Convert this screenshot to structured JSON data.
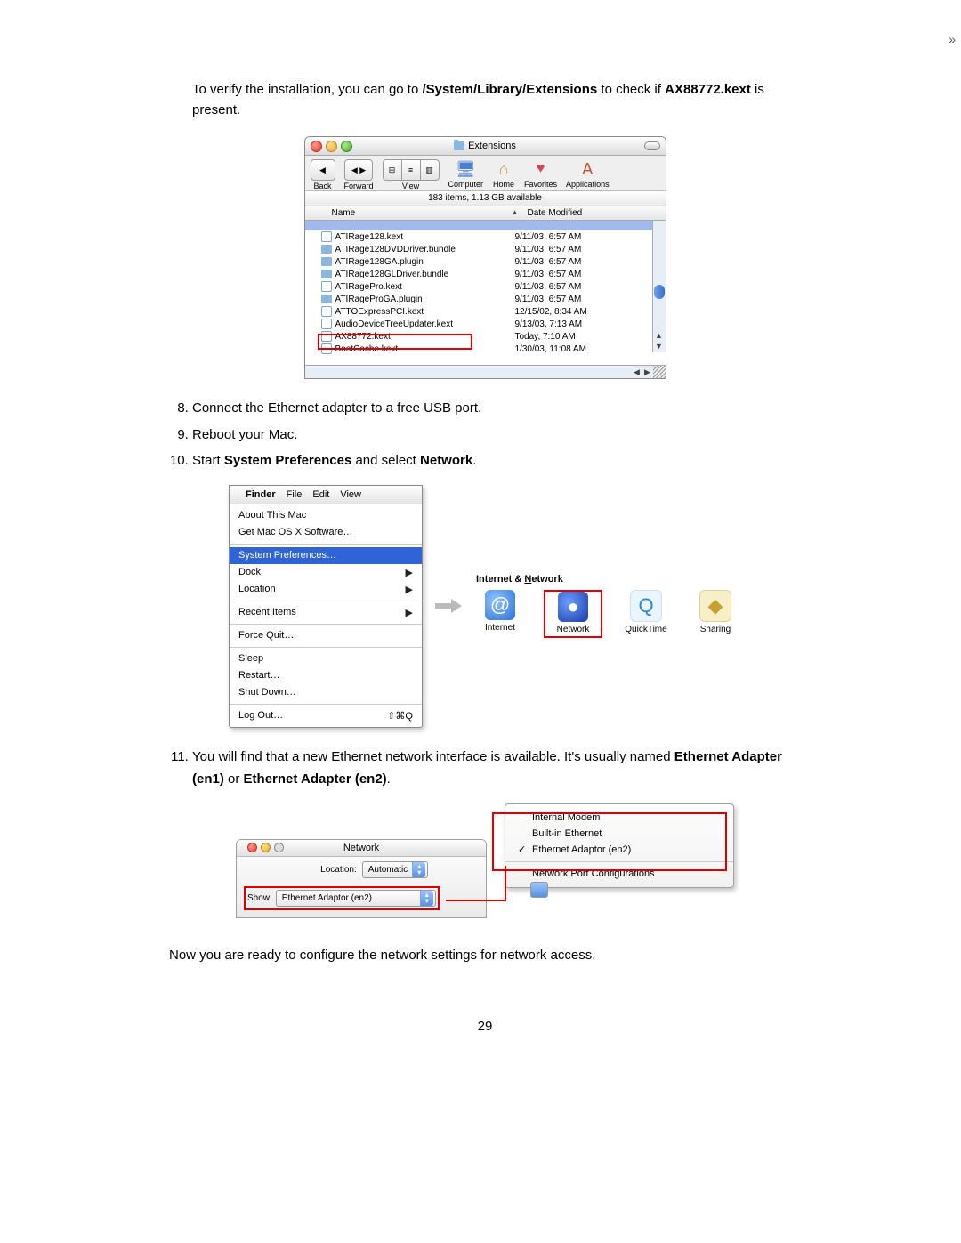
{
  "intro": {
    "pre": "To verify the installation, you can go to ",
    "path": "/System/Library/Extensions",
    "mid": " to check if ",
    "kext": "AX88772.kext",
    "post": " is present."
  },
  "finder": {
    "title": "Extensions",
    "toolbar": {
      "back": "Back",
      "forward": "Forward",
      "view": "View",
      "computer": "Computer",
      "home": "Home",
      "favorites": "Favorites",
      "applications": "Applications"
    },
    "status": "183 items, 1.13 GB available",
    "columns": {
      "name": "Name",
      "date": "Date Modified"
    },
    "files": [
      {
        "name": "ATIRage128.kext",
        "date": "9/11/03, 6:57 AM",
        "type": "kext"
      },
      {
        "name": "ATIRage128DVDDriver.bundle",
        "date": "9/11/03, 6:57 AM",
        "type": "folder"
      },
      {
        "name": "ATIRage128GA.plugin",
        "date": "9/11/03, 6:57 AM",
        "type": "folder"
      },
      {
        "name": "ATIRage128GLDriver.bundle",
        "date": "9/11/03, 6:57 AM",
        "type": "folder"
      },
      {
        "name": "ATIRagePro.kext",
        "date": "9/11/03, 6:57 AM",
        "type": "kext"
      },
      {
        "name": "ATIRageProGA.plugin",
        "date": "9/11/03, 6:57 AM",
        "type": "folder"
      },
      {
        "name": "ATTOExpressPCI.kext",
        "date": "12/15/02, 8:34 AM",
        "type": "kext"
      },
      {
        "name": "AudioDeviceTreeUpdater.kext",
        "date": "9/13/03, 7:13 AM",
        "type": "kext"
      },
      {
        "name": "AX88772.kext",
        "date": "Today, 7:10 AM",
        "type": "kext"
      },
      {
        "name": "BootCache.kext",
        "date": "1/30/03, 11:08 AM",
        "type": "kext"
      }
    ]
  },
  "steps": {
    "s8": "Connect the Ethernet adapter to a free USB port.",
    "s9": "Reboot your Mac.",
    "s10_a": "Start ",
    "s10_b": "System Preferences",
    "s10_c": " and select ",
    "s10_d": "Network",
    "s10_e": ".",
    "s11_a": "You will find that a new Ethernet network interface is available. It's usually named ",
    "s11_b": "Ethernet Adapter (en1)",
    "s11_c": " or ",
    "s11_d": "Ethernet Adapter (en2)",
    "s11_e": "."
  },
  "apple_menu": {
    "menubar": [
      "Finder",
      "File",
      "Edit",
      "View"
    ],
    "items": {
      "about": "About This Mac",
      "getsw": "Get Mac OS X Software…",
      "sysprefs": "System Preferences…",
      "dock": "Dock",
      "location": "Location",
      "recent": "Recent Items",
      "forcequit": "Force Quit…",
      "sleep": "Sleep",
      "restart": "Restart…",
      "shutdown": "Shut Down…",
      "logout": "Log Out…",
      "logout_sc": "⇧⌘Q"
    }
  },
  "prefs": {
    "section": "Internet & ",
    "section_u": "N",
    "section_rest": "etwork",
    "items": {
      "internet": "Internet",
      "network": "Network",
      "quicktime": "QuickTime",
      "sharing": "Sharing"
    }
  },
  "network_window": {
    "title": "Network",
    "location_label": "Location:",
    "location_value": "Automatic",
    "show_label": "Show:",
    "show_value": "Ethernet Adaptor (en2)"
  },
  "dropdown": {
    "items": [
      "Internal Modem",
      "Built-in Ethernet",
      "Ethernet Adaptor (en2)"
    ],
    "config": "Network Port Configurations"
  },
  "closing": "Now you are ready to configure the network settings for network access.",
  "page_number": "29"
}
